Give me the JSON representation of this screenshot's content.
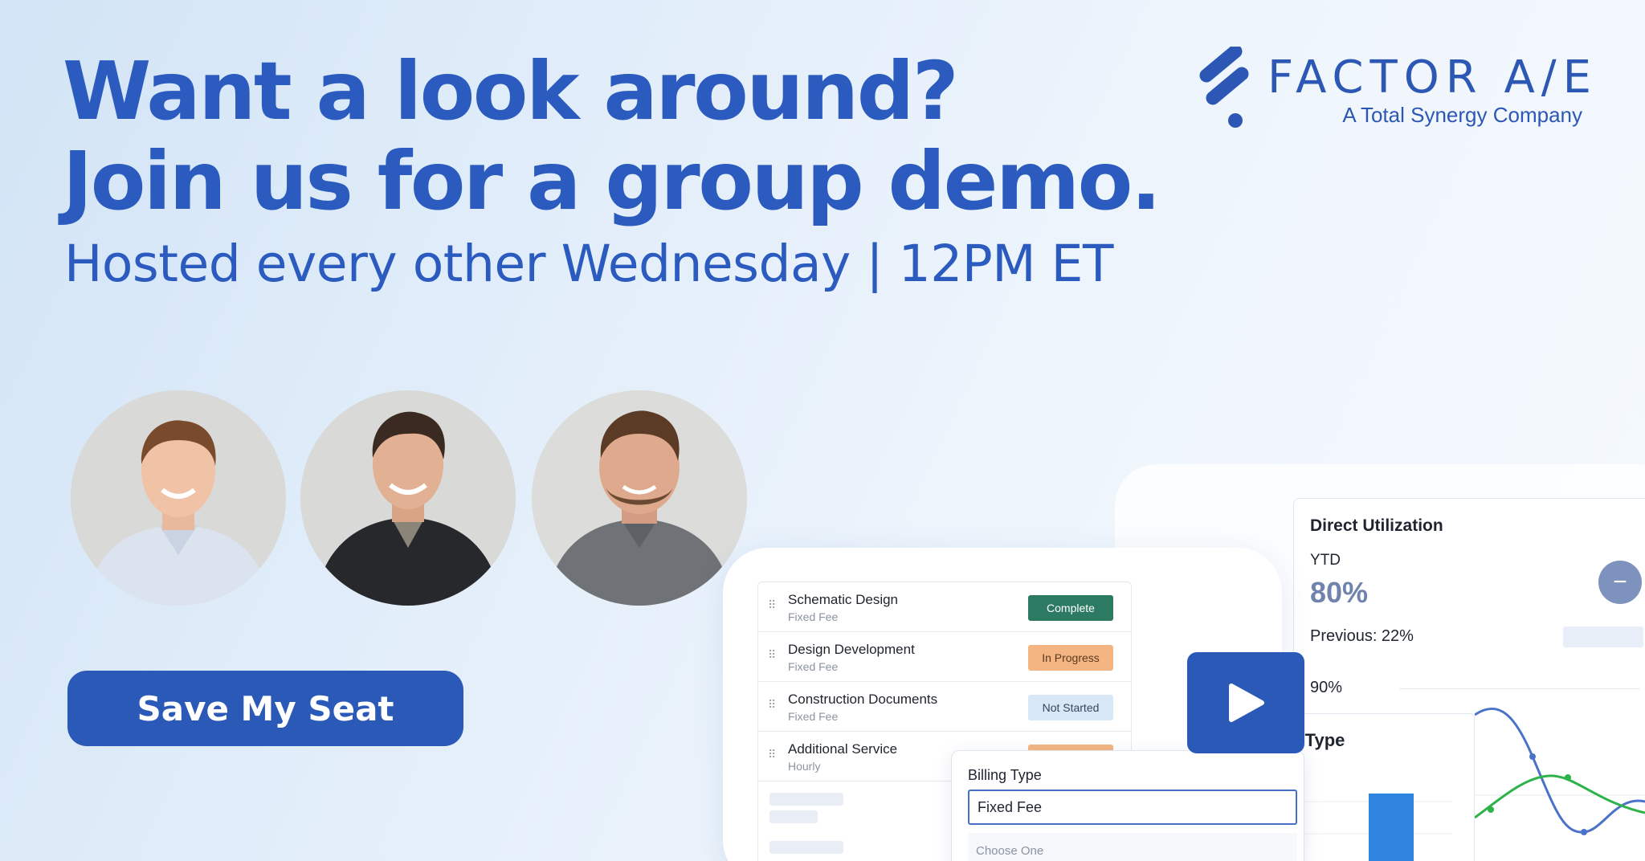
{
  "headline": {
    "line1": "Want a look around?",
    "line2": "Join us for a group demo."
  },
  "subhead": "Hosted every other Wednesday | 12PM ET",
  "logo": {
    "name": "FACTOR A/E",
    "tagline": "A Total Synergy Company",
    "color": "#2d57b4"
  },
  "presenters": [
    {
      "shirt": "light-blue-button-down"
    },
    {
      "shirt": "black-quarter-zip"
    },
    {
      "shirt": "gray-polo"
    }
  ],
  "cta": {
    "label": "Save My Seat",
    "color": "#2b59b8"
  },
  "phases": [
    {
      "name": "Schematic Design",
      "fee": "Fixed Fee",
      "status": "Complete"
    },
    {
      "name": "Design Development",
      "fee": "Fixed Fee",
      "status": "In Progress"
    },
    {
      "name": "Construction Documents",
      "fee": "Fixed Fee",
      "status": "Not Started"
    },
    {
      "name": "Additional Service",
      "fee": "Hourly",
      "status": ""
    }
  ],
  "utilization": {
    "title": "Direct Utilization",
    "period": "YTD",
    "value": "80%",
    "previous": "Previous: 22%",
    "target": "90%"
  },
  "contract": {
    "title_fragment": "ct Type"
  },
  "billing": {
    "label": "Billing Type",
    "value": "Fixed Fee",
    "placeholder": "Choose One"
  },
  "icons": {
    "play": "play-icon",
    "minus": "minus-icon",
    "drag": "drag-handle-icon",
    "logo": "factor-logo-icon"
  }
}
